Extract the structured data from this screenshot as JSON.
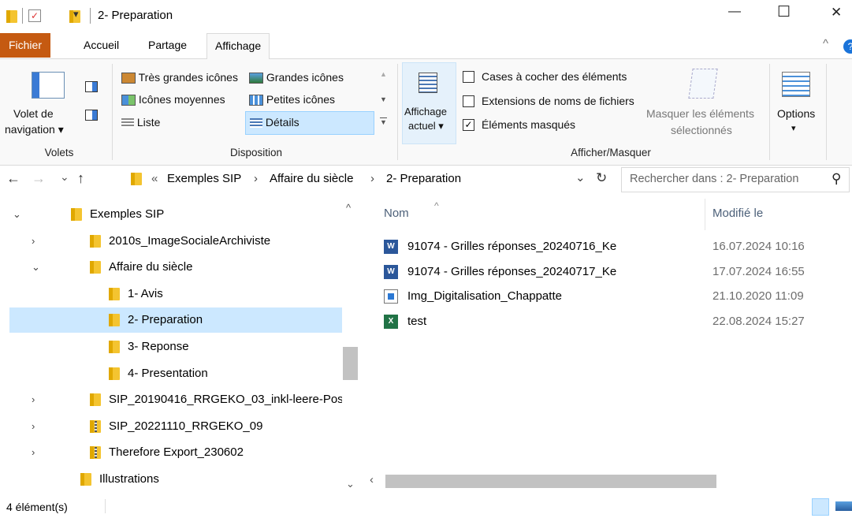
{
  "window": {
    "title": "2- Preparation",
    "minimize": "—",
    "maximize": "☐",
    "close": "✕"
  },
  "ribbon_tabs": [
    "Fichier",
    "Accueil",
    "Partage",
    "Affichage"
  ],
  "ribbon": {
    "volets": {
      "volet_label_1": "Volet de",
      "volet_label_2": "navigation ▾",
      "group_label": "Volets"
    },
    "disposition": {
      "items": [
        "Très grandes icônes",
        "Grandes icônes",
        "Icônes moyennes",
        "Petites icônes",
        "Liste",
        "Détails"
      ],
      "group_label": "Disposition"
    },
    "affichage_actuel": [
      "Affichage",
      "actuel ▾"
    ],
    "afficher_masquer": {
      "checkboxes": [
        {
          "label": "Cases à cocher des éléments",
          "checked": false
        },
        {
          "label": "Extensions de noms de fichiers",
          "checked": false
        },
        {
          "label": "Éléments masqués",
          "checked": true
        }
      ],
      "masquer_1": "Masquer les éléments",
      "masquer_2": "sélectionnés",
      "group_label": "Afficher/Masquer"
    },
    "options_label": "Options",
    "options_arrow": "▾"
  },
  "address": {
    "back": "←",
    "forward": "→",
    "recent": "⌄",
    "up": "↑",
    "overflow": "«",
    "crumbs": [
      "Exemples SIP",
      "Affaire du siècle",
      "2- Preparation"
    ],
    "sep": "›",
    "dropdown": "⌄",
    "refresh": "↻",
    "search_placeholder": "Rechercher dans : 2- Preparation",
    "search_icon": "⚲"
  },
  "tree": [
    {
      "label": "Exemples SIP",
      "indent": 0,
      "chevron": "⌄",
      "selected": false
    },
    {
      "label": "2010s_ImageSocialeArchiviste",
      "indent": 1,
      "chevron": "›",
      "selected": false
    },
    {
      "label": "Affaire du siècle",
      "indent": 1,
      "chevron": "⌄",
      "selected": false
    },
    {
      "label": "1- Avis",
      "indent": 2,
      "chevron": "",
      "selected": false
    },
    {
      "label": "2- Preparation",
      "indent": 2,
      "chevron": "",
      "selected": true
    },
    {
      "label": "3- Reponse",
      "indent": 2,
      "chevron": "",
      "selected": false
    },
    {
      "label": "4- Presentation",
      "indent": 2,
      "chevron": "",
      "selected": false
    },
    {
      "label": "SIP_20190416_RRGEKO_03_inkl-leere-Pos",
      "indent": 1,
      "chevron": "›",
      "selected": false
    },
    {
      "label": "SIP_20221110_RRGEKO_09",
      "indent": 1,
      "chevron": "›",
      "selected": false,
      "zip": true
    },
    {
      "label": "Therefore Export_230602",
      "indent": 1,
      "chevron": "›",
      "selected": false,
      "zip": true
    },
    {
      "label": "Illustrations",
      "indent": 0.5,
      "chevron": "",
      "selected": false
    }
  ],
  "list": {
    "col_name": "Nom",
    "col_modified": "Modifié le",
    "sort_indicator": "^",
    "files": [
      {
        "name": "91074 - Grilles réponses_20240716_Ke",
        "date": "16.07.2024 10:16",
        "type": "word"
      },
      {
        "name": "91074 - Grilles réponses_20240717_Ke",
        "date": "17.07.2024 16:55",
        "type": "word"
      },
      {
        "name": "Img_Digitalisation_Chappatte",
        "date": "21.10.2020 11:09",
        "type": "image"
      },
      {
        "name": "test",
        "date": "22.08.2024 15:27",
        "type": "excel"
      }
    ]
  },
  "status": {
    "count": "4 élément(s)"
  },
  "colors": {
    "accent_tab": "#c55a11",
    "selection": "#cce8ff",
    "selection_border": "#99d1ff",
    "help_badge": "#1a73d9"
  }
}
